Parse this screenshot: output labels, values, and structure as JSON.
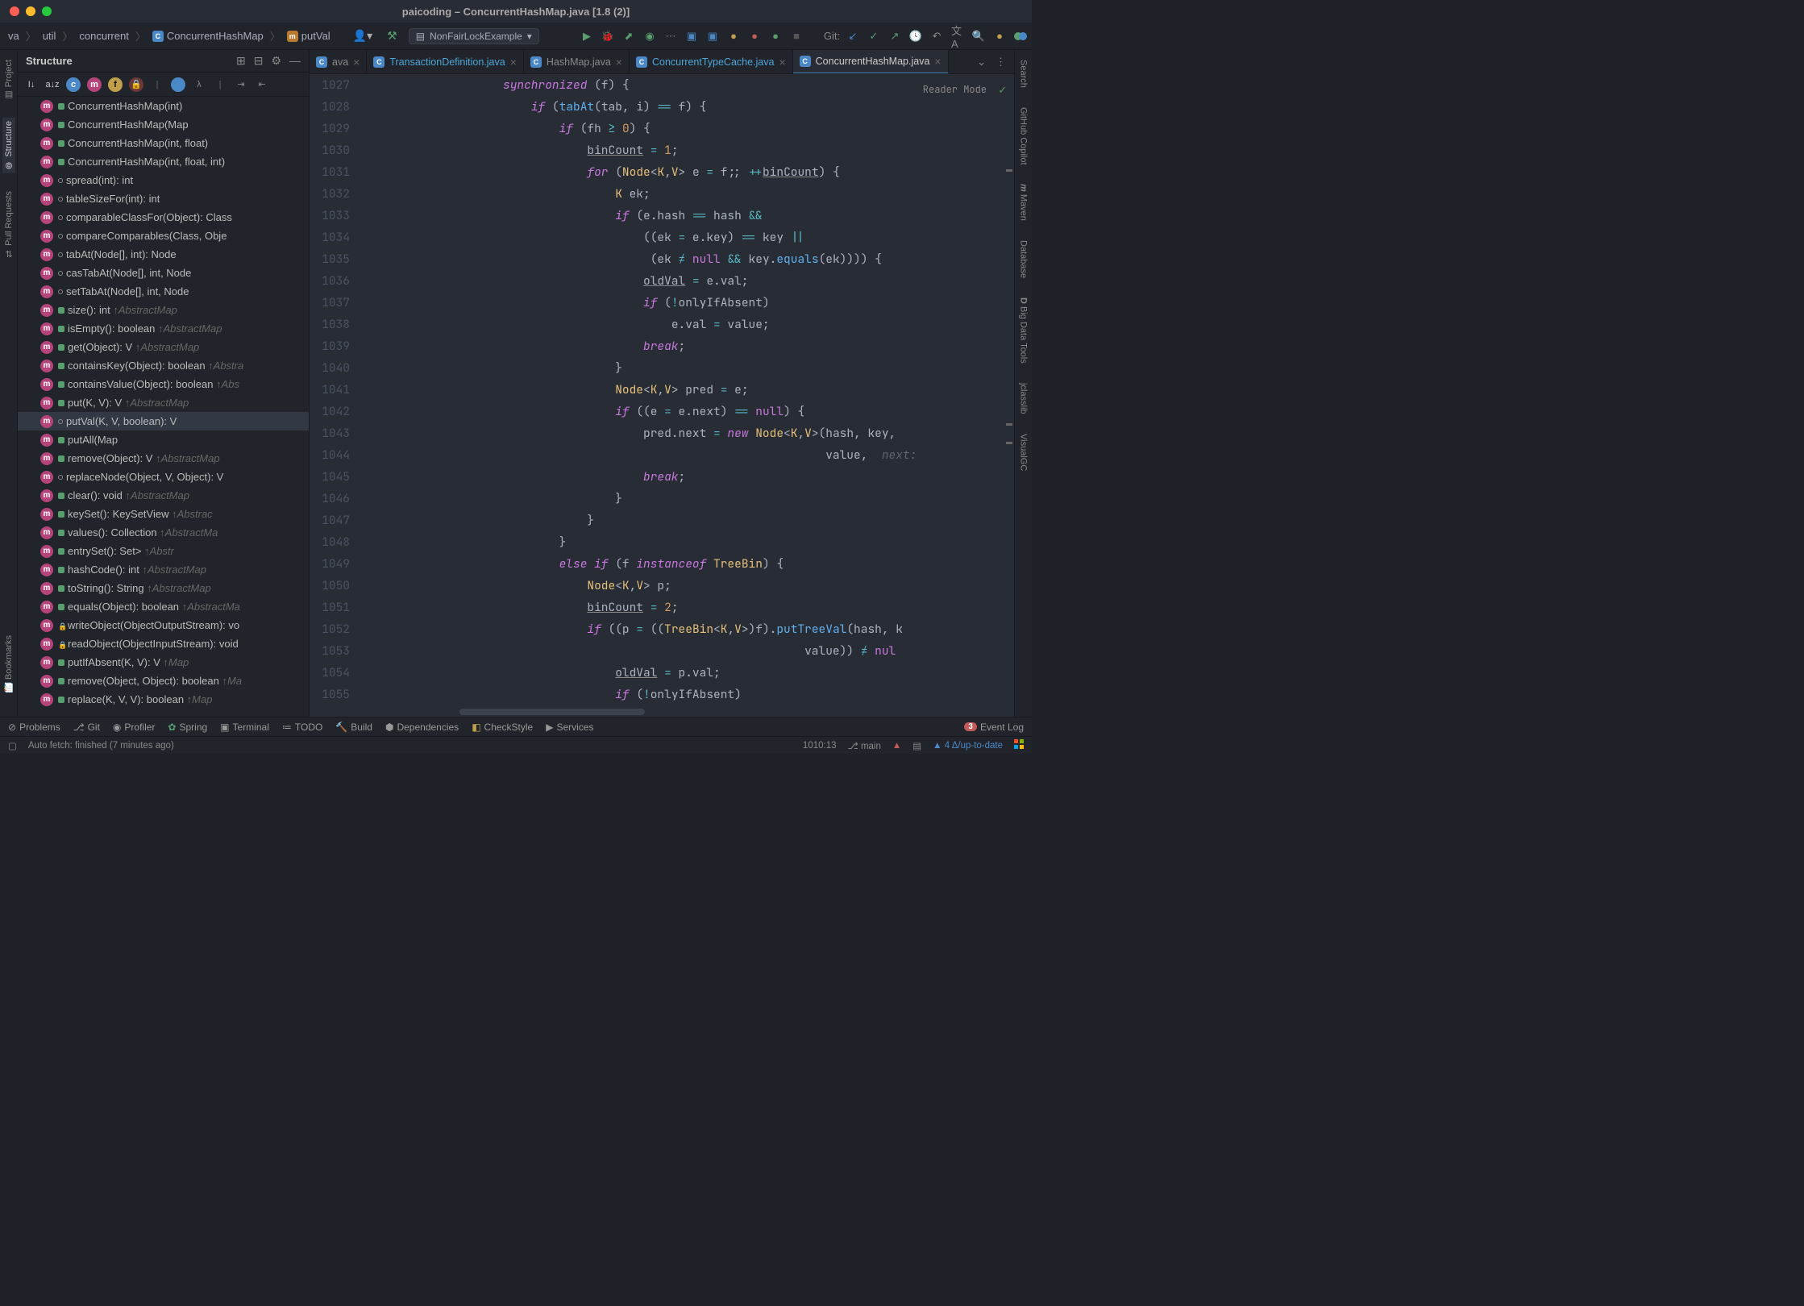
{
  "title": "paicoding – ConcurrentHashMap.java [1.8 (2)]",
  "breadcrumb": [
    "va",
    "util",
    "concurrent",
    "ConcurrentHashMap",
    "putVal"
  ],
  "run_config": "NonFairLockExample",
  "git_label": "Git:",
  "left_tabs": [
    "Project",
    "Structure",
    "Pull Requests",
    "Bookmarks"
  ],
  "right_tabs": [
    "Search",
    "GitHub Copilot",
    "Maven",
    "Database",
    "Big Data Tools",
    "jclasslib",
    "VisualGC"
  ],
  "structure": {
    "title": "Structure",
    "items": [
      {
        "t": "ConcurrentHashMap(int)",
        "kind": "ctor"
      },
      {
        "t": "ConcurrentHashMap(Map<? extends K",
        "kind": "ctor"
      },
      {
        "t": "ConcurrentHashMap(int, float)",
        "kind": "ctor"
      },
      {
        "t": "ConcurrentHashMap(int, float, int)",
        "kind": "ctor"
      },
      {
        "t": "spread(int): int",
        "kind": "static"
      },
      {
        "t": "tableSizeFor(int): int",
        "kind": "static-lock"
      },
      {
        "t": "comparableClassFor(Object): Class<?>",
        "kind": "static"
      },
      {
        "t": "compareComparables(Class<?>, Obje",
        "kind": "static"
      },
      {
        "t": "tabAt(Node<K, V>[], int): Node<K, V>",
        "kind": "static"
      },
      {
        "t": "casTabAt(Node<K, V>[], int, Node<K, V",
        "kind": "static"
      },
      {
        "t": "setTabAt(Node<K, V>[], int, Node<K, V",
        "kind": "static"
      },
      {
        "t": "size(): int",
        "inh": "↑AbstractMap"
      },
      {
        "t": "isEmpty(): boolean",
        "inh": "↑AbstractMap"
      },
      {
        "t": "get(Object): V",
        "inh": "↑AbstractMap"
      },
      {
        "t": "containsKey(Object): boolean",
        "inh": "↑Abstra"
      },
      {
        "t": "containsValue(Object): boolean",
        "inh": "↑Abs"
      },
      {
        "t": "put(K, V): V",
        "inh": "↑AbstractMap"
      },
      {
        "t": "putVal(K, V, boolean): V",
        "sel": true,
        "kind": "final"
      },
      {
        "t": "putAll(Map<? extends K, ? extends V>"
      },
      {
        "t": "remove(Object): V",
        "inh": "↑AbstractMap"
      },
      {
        "t": "replaceNode(Object, V, Object): V",
        "kind": "final"
      },
      {
        "t": "clear(): void",
        "inh": "↑AbstractMap"
      },
      {
        "t": "keySet(): KeySetView<K, V>",
        "inh": "↑Abstrac"
      },
      {
        "t": "values(): Collection<V>",
        "inh": "↑AbstractMa"
      },
      {
        "t": "entrySet(): Set<Entry<K, V>>",
        "inh": "↑Abstr"
      },
      {
        "t": "hashCode(): int",
        "inh": "↑AbstractMap"
      },
      {
        "t": "toString(): String",
        "inh": "↑AbstractMap"
      },
      {
        "t": "equals(Object): boolean",
        "inh": "↑AbstractMa"
      },
      {
        "t": "writeObject(ObjectOutputStream): vo",
        "kind": "lock"
      },
      {
        "t": "readObject(ObjectInputStream): void",
        "kind": "lock"
      },
      {
        "t": "putIfAbsent(K, V): V",
        "inh": "↑Map"
      },
      {
        "t": "remove(Object, Object): boolean",
        "inh": "↑Ma"
      },
      {
        "t": "replace(K, V, V): boolean",
        "inh": "↑Map"
      }
    ]
  },
  "tabs": [
    {
      "label": "ava"
    },
    {
      "label": "TransactionDefinition.java",
      "blue": true
    },
    {
      "label": "HashMap.java"
    },
    {
      "label": "ConcurrentTypeCache.java",
      "blue": true
    },
    {
      "label": "ConcurrentHashMap.java",
      "active": true
    }
  ],
  "reader_mode": "Reader Mode",
  "line_start": 1027,
  "code": [
    "                    <kw>synchronized</kw> <pn>(f) {</pn>",
    "                        <kw>if</kw> <pn>(</pn><fn>tabAt</fn><pn>(tab, i)</pn> <op>==</op> <pn>f) {</pn>",
    "                            <kw>if</kw> <pn>(fh</pn> <op>≥</op> <num>0</num><pn>) {</pn>",
    "                                <pn><span class='underline'>binCount</span></pn> <op>=</op> <num>1</num><pn>;</pn>",
    "                                <kw>for</kw> <pn>(</pn><type>Node</type><pn>&lt;</pn><type>K</type><pn>,</pn><type>V</type><pn>&gt; e</pn> <op>=</op> <pn>f;;</pn> <op>++</op><pn><span class='underline'>binCount</span>) {</pn>",
    "                                    <type>K</type> <pn>ek;</pn>",
    "                                    <kw>if</kw> <pn>(e.hash</pn> <op>==</op> <pn>hash</pn> <op>&amp;&amp;</op>",
    "                                        <pn>((ek</pn> <op>=</op> <pn>e.key)</pn> <op>==</op> <pn>key</pn> <op>||</op>",
    "                                         <pn>(ek</pn> <op>≠</op> <kw2>null</kw2> <op>&amp;&amp;</op> <pn>key.</pn><fn>equals</fn><pn>(ek)))) {</pn>",
    "                                        <pn><span class='underline'>oldVal</span></pn> <op>=</op> <pn>e.val;</pn>",
    "                                        <kw>if</kw> <pn>(</pn><op>!</op><pn>onlyIfAbsent)</pn>",
    "                                            <pn>e.val</pn> <op>=</op> <pn>value;</pn>",
    "                                        <kw>break</kw><pn>;</pn>",
    "                                    <pn>}</pn>",
    "                                    <type>Node</type><pn>&lt;</pn><type>K</type><pn>,</pn><type>V</type><pn>&gt; pred</pn> <op>=</op> <pn>e;</pn>",
    "                                    <kw>if</kw> <pn>((e</pn> <op>=</op> <pn>e.next)</pn> <op>==</op> <kw2>null</kw2><pn>) {</pn>",
    "                                        <pn>pred.next</pn> <op>=</op> <kw>new</kw> <type>Node</type><pn>&lt;</pn><type>K</type><pn>,</pn><type>V</type><pn>&gt;(hash, key,</pn>",
    "                                                                  <pn>value,</pn>  <cmt>next:</cmt>",
    "                                        <kw>break</kw><pn>;</pn>",
    "                                    <pn>}</pn>",
    "                                <pn>}</pn>",
    "                            <pn>}</pn>",
    "                            <kw>else if</kw> <pn>(f</pn> <kw>instanceof</kw> <type>TreeBin</type><pn>) {</pn>",
    "                                <type>Node</type><pn>&lt;</pn><type>K</type><pn>,</pn><type>V</type><pn>&gt; p;</pn>",
    "                                <pn><span class='underline'>binCount</span></pn> <op>=</op> <num>2</num><pn>;</pn>",
    "                                <kw>if</kw> <pn>((p</pn> <op>=</op> <pn>((</pn><type>TreeBin</type><pn>&lt;</pn><type>K</type><pn>,</pn><type>V</type><pn>&gt;)f).</pn><fn>putTreeVal</fn><pn>(hash, k</pn>",
    "                                                               <pn>value))</pn> <op>≠</op> <kw2>nul</kw2>",
    "                                    <pn><span class='underline'>oldVal</span></pn> <op>=</op> <pn>p.val;</pn>",
    "                                    <kw>if</kw> <pn>(</pn><op>!</op><pn>onlyIfAbsent)</pn>"
  ],
  "tools": [
    "Problems",
    "Git",
    "Profiler",
    "Spring",
    "Terminal",
    "TODO",
    "Build",
    "Dependencies",
    "CheckStyle",
    "Services"
  ],
  "event_log": {
    "count": "3",
    "label": "Event Log"
  },
  "status": {
    "msg": "Auto fetch: finished (7 minutes ago)",
    "pos": "1010:13",
    "branch": "main",
    "sync": "4 Δ/up-to-date"
  }
}
